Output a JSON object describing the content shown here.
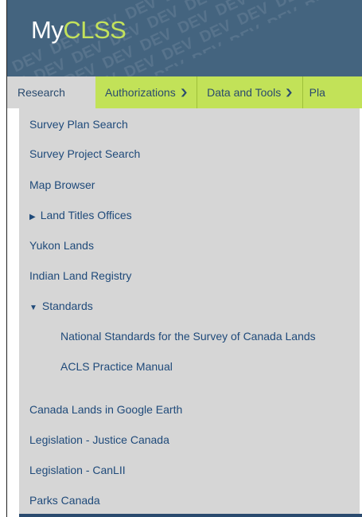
{
  "app": {
    "logo_prefix": "My",
    "logo_accent": "CLSS",
    "watermark": "DEV"
  },
  "nav": {
    "items": [
      {
        "label": "Research",
        "active": true
      },
      {
        "label": "Authorizations",
        "dropdown": true
      },
      {
        "label": "Data and Tools",
        "dropdown": true
      },
      {
        "label": "Pla"
      }
    ]
  },
  "menu": {
    "items": [
      {
        "label": "Survey Plan Search"
      },
      {
        "label": "Survey Project Search"
      },
      {
        "label": "Map Browser"
      },
      {
        "label": "Land Titles Offices",
        "expander": "▶"
      },
      {
        "label": "Yukon Lands"
      },
      {
        "label": "Indian Land Registry"
      },
      {
        "label": "Standards",
        "expander": "▼"
      },
      {
        "label": "National Standards for the Survey of Canada Lands",
        "sub": true
      },
      {
        "label": "ACLS Practice Manual",
        "sub": true
      },
      {
        "label": "Canada Lands in Google Earth"
      },
      {
        "label": "Legislation - Justice Canada"
      },
      {
        "label": "Legislation - CanLII"
      },
      {
        "label": "Parks Canada"
      }
    ]
  },
  "colors": {
    "header": "#44647f",
    "navbar": "#c2e258",
    "accent": "#c3e25b",
    "menu_bg": "#d6d6d6",
    "link": "#1f4a7a"
  }
}
